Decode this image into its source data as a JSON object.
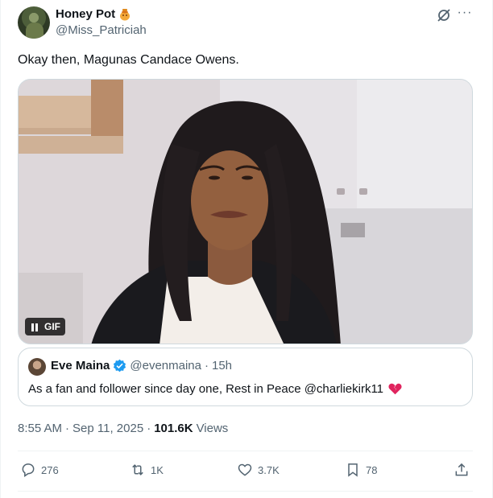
{
  "author": {
    "name": "Honey Pot",
    "name_emoji_icon": "honey-pot-icon",
    "handle": "@Miss_Patriciah"
  },
  "tweet": {
    "text": "Okay then, Magunas Candace Owens.",
    "media": {
      "type": "gif",
      "badge_label": "GIF",
      "control_icon": "pause-icon"
    }
  },
  "quoted_tweet": {
    "name": "Eve Maina",
    "verified": true,
    "handle": "@evenmaina",
    "separator": "·",
    "age": "15h",
    "text": "As a fan and follower since day one, Rest in Peace @charliekirk11",
    "emoji_icon": "broken-heart-icon"
  },
  "meta": {
    "time": "8:55 AM",
    "separator": "·",
    "date": "Sep 11, 2025",
    "views_count": "101.6K",
    "views_label": "Views"
  },
  "actions": {
    "replies": "276",
    "reposts": "1K",
    "likes": "3.7K",
    "bookmarks": "78"
  },
  "colors": {
    "text_primary": "#0f1419",
    "text_secondary": "#536471",
    "border": "#cfd9de",
    "verified_blue": "#1d9bf0",
    "broken_heart_red": "#e0245e"
  }
}
